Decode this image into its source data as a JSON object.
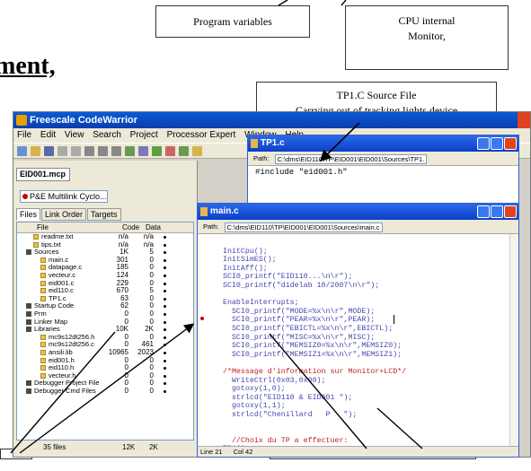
{
  "callouts": {
    "program_variables": "Program variables",
    "cpu_line1": "CPU internal",
    "cpu_line2": "Monitor,",
    "tp1_line1": "TP1.C Source File",
    "tp1_line2": "Carrying out of tracking lights device"
  },
  "heading": "ment,",
  "app": {
    "title": "Freescale CodeWarrior",
    "menu": [
      "File",
      "Edit",
      "View",
      "Search",
      "Project",
      "Processor Expert",
      "Window",
      "Help"
    ]
  },
  "project": {
    "tab": "EID001.mcp",
    "target": "P&E Multilink Cyclo...",
    "subtabs": [
      "Files",
      "Link Order",
      "Targets"
    ],
    "columns": [
      "File",
      "Code",
      "Data"
    ],
    "files": [
      {
        "name": "readme.txt",
        "code": "n/a",
        "data": "n/a",
        "indent": 1,
        "type": "f"
      },
      {
        "name": "tips.txt",
        "code": "n/a",
        "data": "n/a",
        "indent": 1,
        "type": "f"
      },
      {
        "name": "Sources",
        "code": "1K",
        "data": "5",
        "indent": 0,
        "type": "d"
      },
      {
        "name": "main.c",
        "code": "301",
        "data": "0",
        "indent": 2,
        "type": "f"
      },
      {
        "name": "datapage.c",
        "code": "185",
        "data": "0",
        "indent": 2,
        "type": "f"
      },
      {
        "name": "vecteur.c",
        "code": "124",
        "data": "0",
        "indent": 2,
        "type": "f"
      },
      {
        "name": "eid001.c",
        "code": "229",
        "data": "0",
        "indent": 2,
        "type": "f"
      },
      {
        "name": "eid110.c",
        "code": "670",
        "data": "5",
        "indent": 2,
        "type": "f"
      },
      {
        "name": "TP1.c",
        "code": "63",
        "data": "0",
        "indent": 2,
        "type": "f"
      },
      {
        "name": "Startup Code",
        "code": "62",
        "data": "0",
        "indent": 0,
        "type": "d"
      },
      {
        "name": "Prm",
        "code": "0",
        "data": "0",
        "indent": 0,
        "type": "d"
      },
      {
        "name": "Linker Map",
        "code": "0",
        "data": "0",
        "indent": 0,
        "type": "d"
      },
      {
        "name": "Libraries",
        "code": "10K",
        "data": "2K",
        "indent": 0,
        "type": "d"
      },
      {
        "name": "mc9s12dt256.h",
        "code": "0",
        "data": "0",
        "indent": 2,
        "type": "f"
      },
      {
        "name": "mc9s12dt256.c",
        "code": "0",
        "data": "461",
        "indent": 2,
        "type": "f"
      },
      {
        "name": "ansili.lib",
        "code": "10965",
        "data": "2023",
        "indent": 2,
        "type": "f"
      },
      {
        "name": "eid001.h",
        "code": "0",
        "data": "0",
        "indent": 2,
        "type": "f"
      },
      {
        "name": "eid110.h",
        "code": "0",
        "data": "0",
        "indent": 2,
        "type": "f"
      },
      {
        "name": "vecteur.h",
        "code": "0",
        "data": "0",
        "indent": 2,
        "type": "f"
      },
      {
        "name": "Debugger Project File",
        "code": "0",
        "data": "0",
        "indent": 0,
        "type": "d"
      },
      {
        "name": "Debugger Cmd Files",
        "code": "0",
        "data": "0",
        "indent": 0,
        "type": "d"
      }
    ],
    "status": {
      "files": "35 files",
      "code": "12K",
      "data": "2K"
    }
  },
  "tp1_window": {
    "title": "TP1.c",
    "path_label": "Path:",
    "path": "C:\\dms\\EID110\\TP\\EID001\\EID001\\Sources\\TP1.",
    "code": [
      "#include \"eid001.h\""
    ]
  },
  "main_window": {
    "title": "main.c",
    "path_label": "Path:",
    "path": "C:\\dms\\EID110\\TP\\EID001\\EID001\\Sources\\main.c",
    "status_line": "Line 21",
    "status_col": "Col 42"
  },
  "colors": {
    "title_blue": "#0b3fc7",
    "code_blue": "#4646b0",
    "comment_red": "#c02020"
  }
}
